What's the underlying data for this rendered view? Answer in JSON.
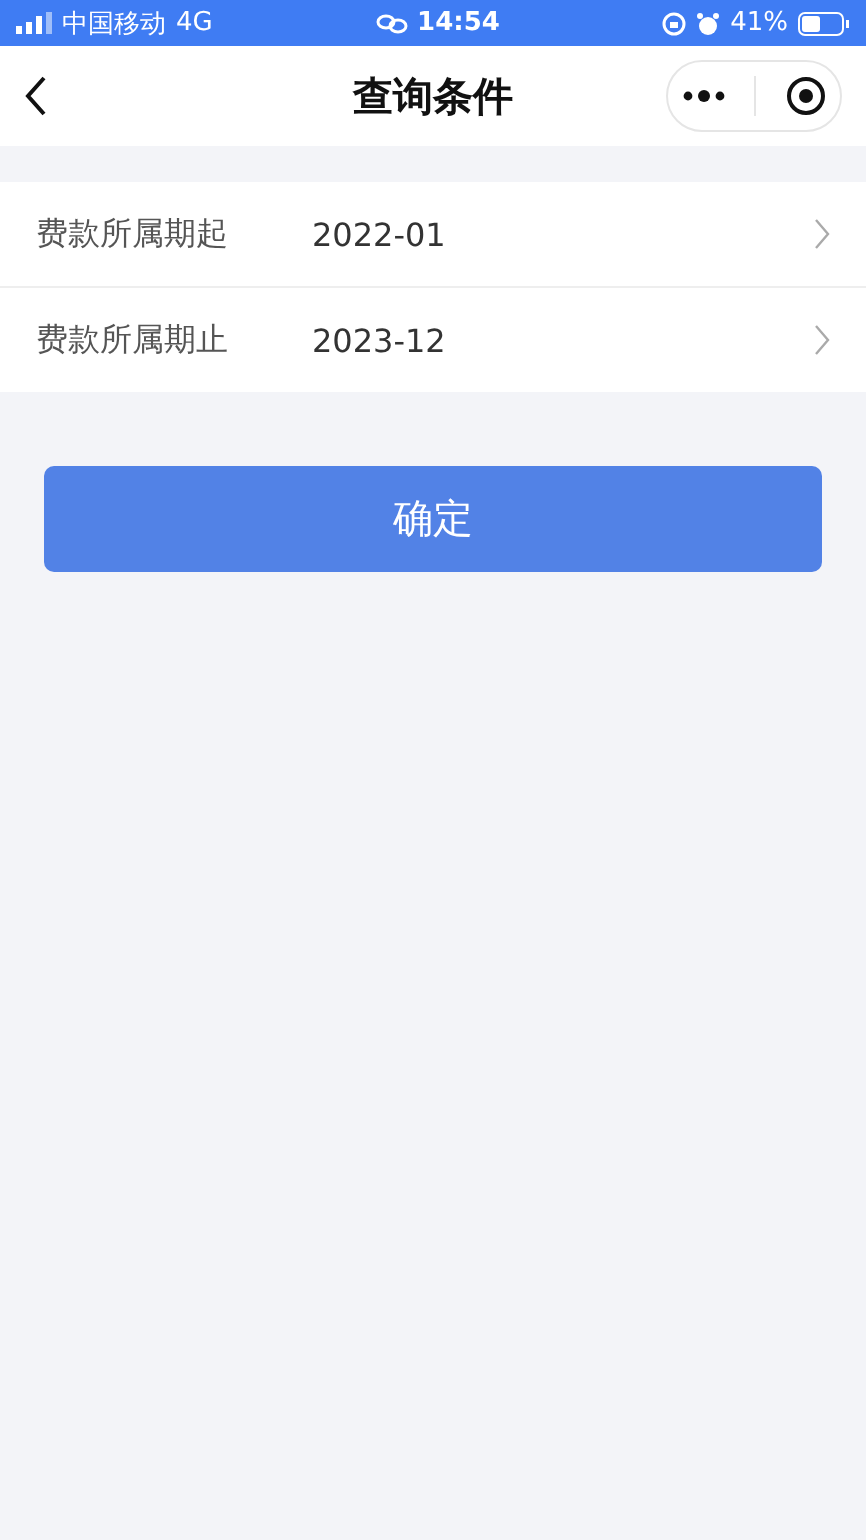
{
  "status_bar": {
    "carrier": "中国移动",
    "network": "4G",
    "time": "14:54",
    "battery": "41%"
  },
  "nav": {
    "title": "查询条件"
  },
  "fields": [
    {
      "label": "费款所属期起",
      "value": "2022-01"
    },
    {
      "label": "费款所属期止",
      "value": "2023-12"
    }
  ],
  "confirm_button": "确定"
}
